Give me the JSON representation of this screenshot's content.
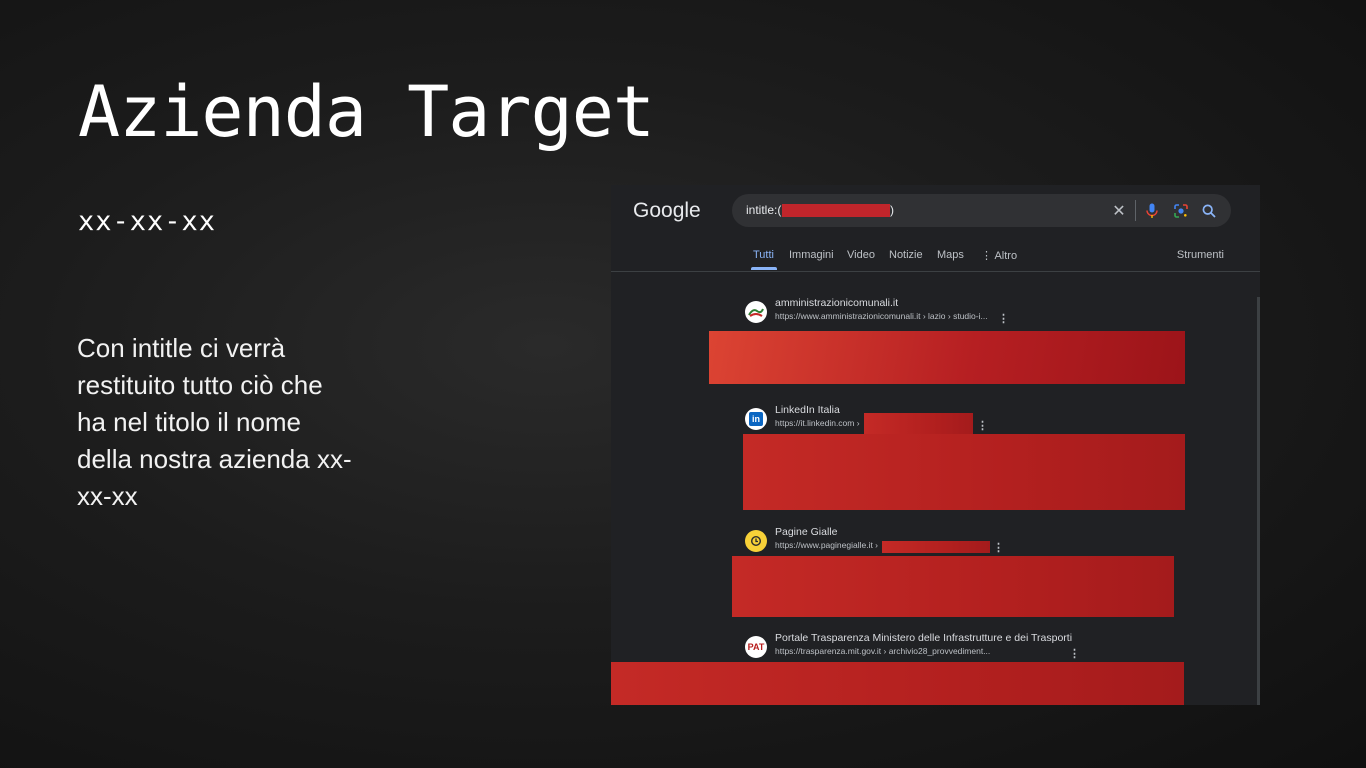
{
  "slide": {
    "title": "Azienda Target",
    "date": "xx-xx-xx",
    "body": "Con intitle ci verrà restituito tutto ciò che ha nel titolo il nome della nostra azienda xx-xx-xx"
  },
  "google": {
    "logo": "Google",
    "query_prefix": "intitle:(",
    "query_suffix": ")",
    "icons": [
      "close-icon",
      "mic-icon",
      "lens-icon",
      "search-icon"
    ],
    "tabs": [
      "Tutti",
      "Immagini",
      "Video",
      "Notizie",
      "Maps",
      "⋮ Altro"
    ],
    "active_tab": "Tutti",
    "tools": "Strumenti",
    "results": [
      {
        "name": "amministrazionicomunali.it",
        "url": "https://www.amministrazionicomunali.it › lazio › studio-i...",
        "favicon": "amministrazioni-logo-icon"
      },
      {
        "name": "LinkedIn Italia",
        "url": "https://it.linkedin.com ›",
        "favicon": "linkedin-icon"
      },
      {
        "name": "Pagine Gialle",
        "url": "https://www.paginegialle.it ›",
        "favicon": "paginegialle-icon"
      },
      {
        "name": "Portale Trasparenza Ministero delle Infrastrutture e dei Trasporti",
        "url": "https://trasparenza.mit.gov.it › archivio28_provvediment...",
        "favicon": "pat-icon"
      }
    ],
    "more_symbol": "⋮",
    "linkedin_mark": "in",
    "pat_mark": "PAT"
  },
  "colors": {
    "redaction": "#c0252b",
    "accent": "#8ab4f8"
  }
}
